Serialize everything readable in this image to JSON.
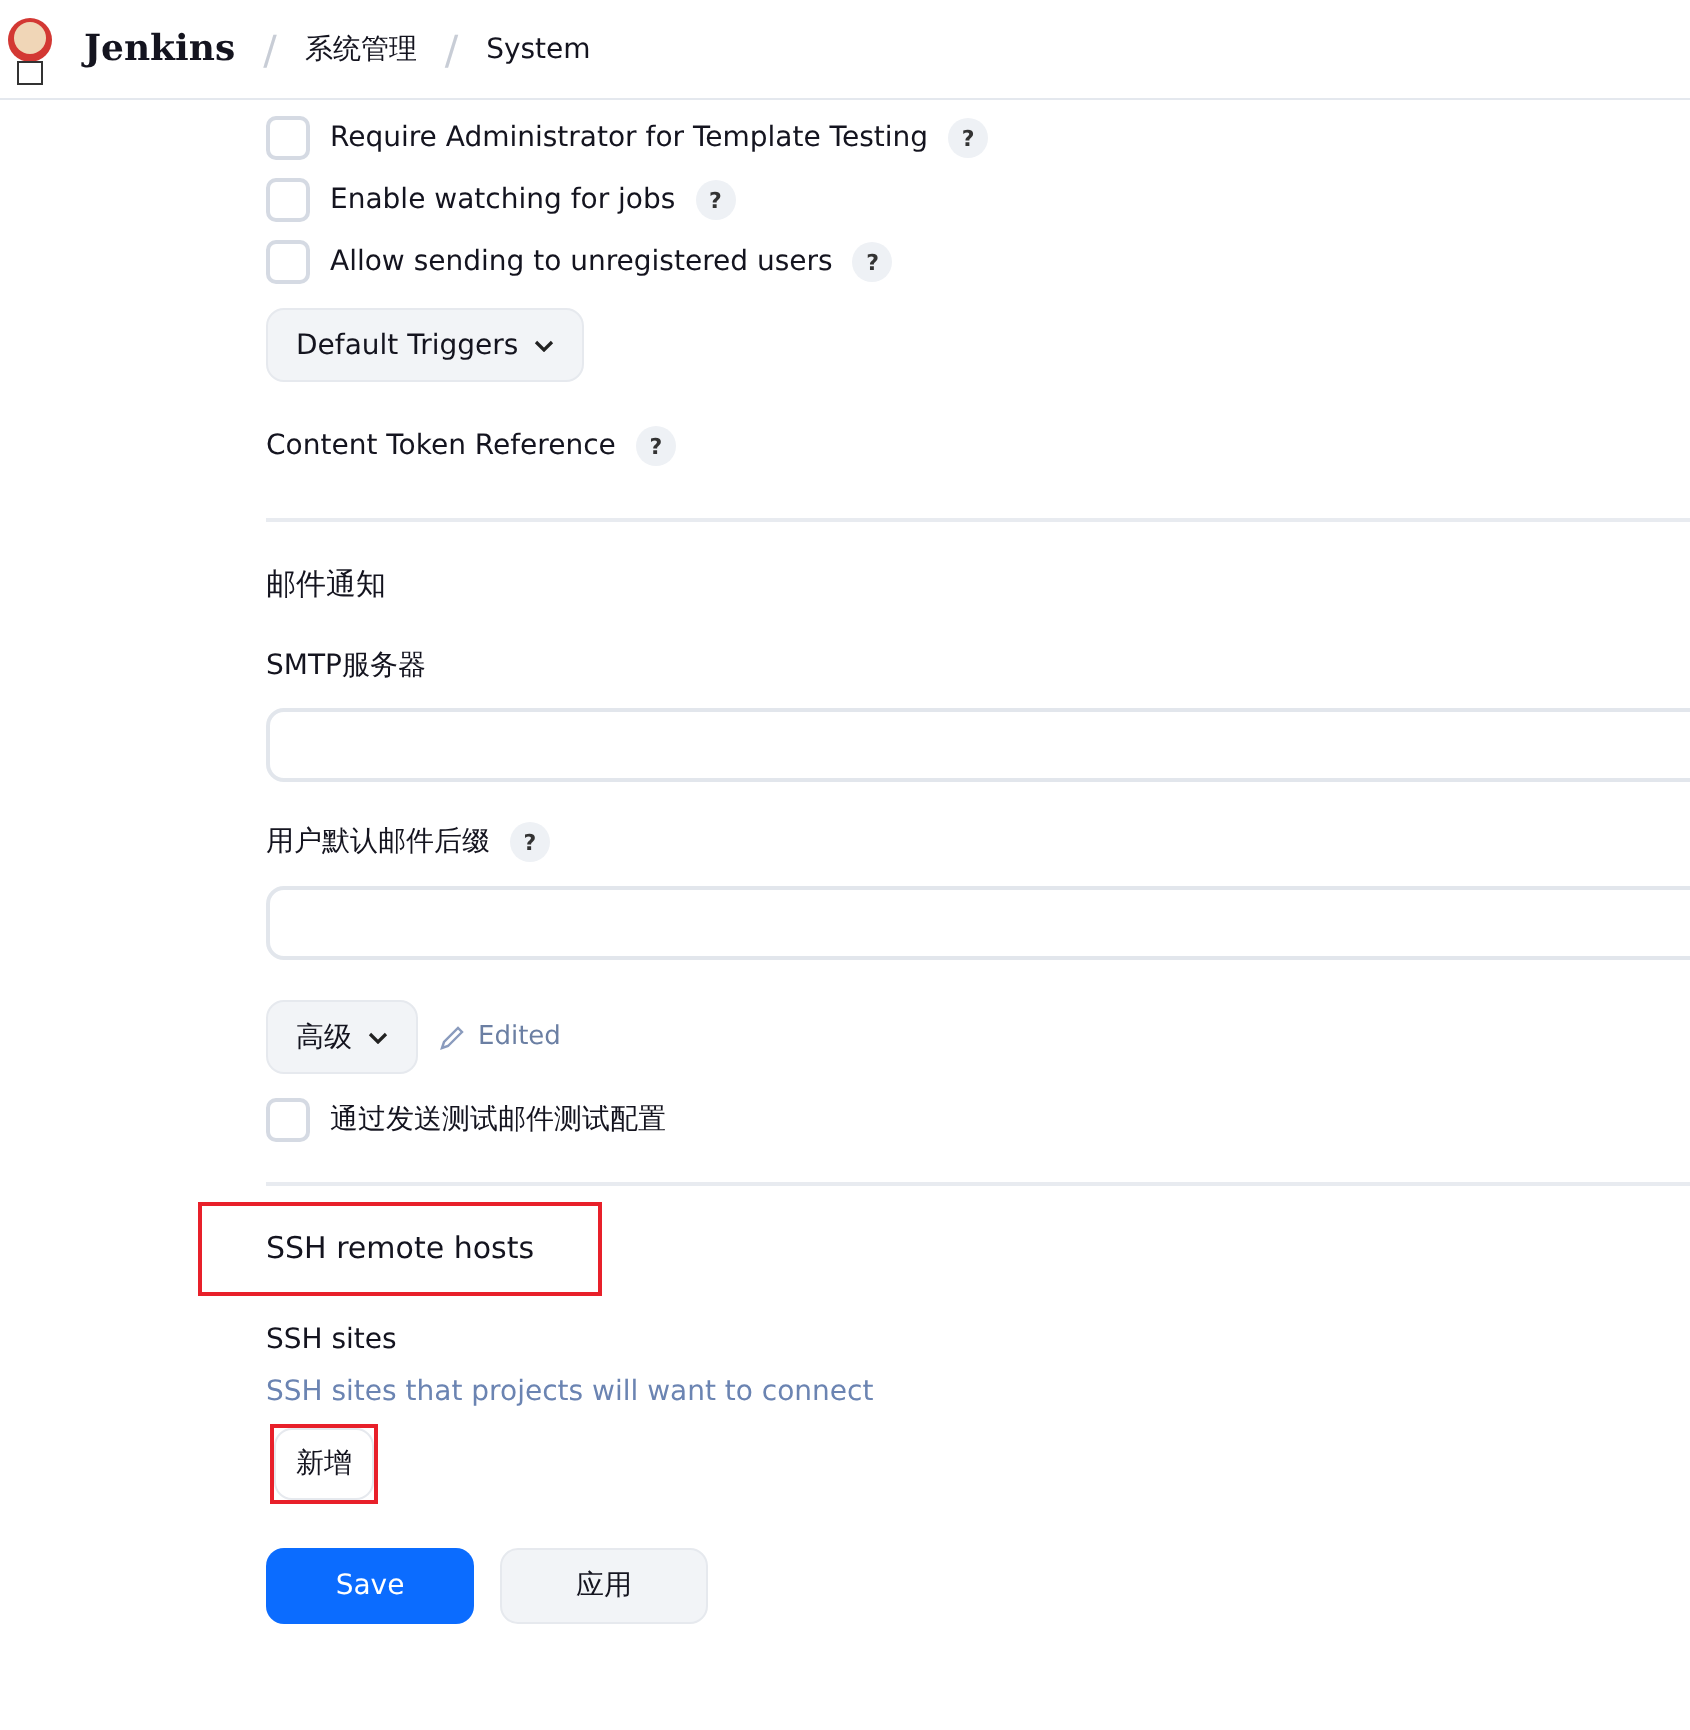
{
  "header": {
    "brand": "Jenkins",
    "breadcrumbs": [
      "系统管理",
      "System"
    ],
    "separator": "/"
  },
  "options": [
    {
      "label": "Require Administrator for Template Testing",
      "checked": false,
      "help": "?"
    },
    {
      "label": "Enable watching for jobs",
      "checked": false,
      "help": "?"
    },
    {
      "label": "Allow sending to unregistered users",
      "checked": false,
      "help": "?"
    }
  ],
  "default_triggers": {
    "label": "Default Triggers"
  },
  "content_token": {
    "label": "Content Token Reference",
    "help": "?"
  },
  "mail": {
    "title": "邮件通知",
    "smtp_label": "SMTP服务器",
    "suffix_label": "用户默认邮件后缀",
    "suffix_help": "?",
    "advanced": "高级",
    "edited": "Edited",
    "test": {
      "label": "通过发送测试邮件测试配置",
      "checked": false
    }
  },
  "ssh": {
    "title": "SSH remote hosts",
    "title_highlighted": true,
    "sites_label": "SSH sites",
    "sites_description": "SSH sites that projects will want to connect",
    "add": "新增",
    "add_highlighted": true
  },
  "buttons": [
    {
      "label": "Save",
      "kind": "primary"
    },
    {
      "label": "应用",
      "kind": "secondary"
    }
  ]
}
